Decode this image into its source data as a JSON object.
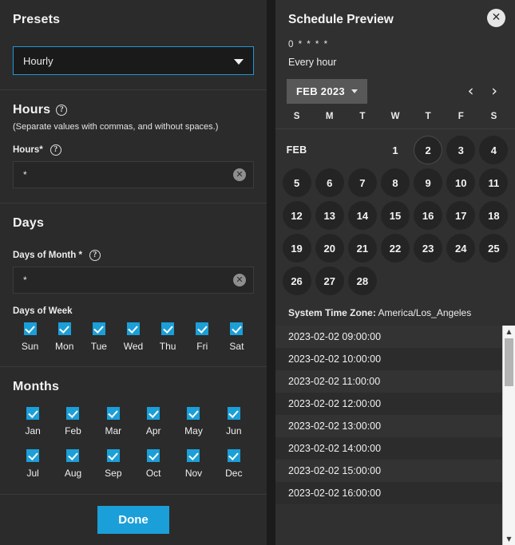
{
  "left": {
    "presets": {
      "title": "Presets",
      "value": "Hourly",
      "caret_icon": "chevron-down-icon"
    },
    "hours": {
      "title": "Hours",
      "help_icon": "?",
      "hint": "(Separate values with commas, and without spaces.)",
      "field_label": "Hours",
      "required_mark": "*",
      "value": "*",
      "clear_icon": "✕"
    },
    "days": {
      "title": "Days",
      "day_of_month_label": "Days of Month",
      "required_mark": "*",
      "day_of_month_value": "*",
      "clear_icon": "✕",
      "days_of_week_label": "Days of Week",
      "week": [
        {
          "label": "Sun",
          "checked": true
        },
        {
          "label": "Mon",
          "checked": true
        },
        {
          "label": "Tue",
          "checked": true
        },
        {
          "label": "Wed",
          "checked": true
        },
        {
          "label": "Thu",
          "checked": true
        },
        {
          "label": "Fri",
          "checked": true
        },
        {
          "label": "Sat",
          "checked": true
        }
      ]
    },
    "months": {
      "title": "Months",
      "items": [
        {
          "label": "Jan",
          "checked": true
        },
        {
          "label": "Feb",
          "checked": true
        },
        {
          "label": "Mar",
          "checked": true
        },
        {
          "label": "Apr",
          "checked": true
        },
        {
          "label": "May",
          "checked": true
        },
        {
          "label": "Jun",
          "checked": true
        },
        {
          "label": "Jul",
          "checked": true
        },
        {
          "label": "Aug",
          "checked": true
        },
        {
          "label": "Sep",
          "checked": true
        },
        {
          "label": "Oct",
          "checked": true
        },
        {
          "label": "Nov",
          "checked": true
        },
        {
          "label": "Dec",
          "checked": true
        }
      ]
    },
    "footer": {
      "done_label": "Done"
    }
  },
  "right": {
    "title": "Schedule Preview",
    "close_icon": "✕",
    "cron_expression": "0 * * * *",
    "cron_description": "Every hour",
    "calendar": {
      "month_chip": "FEB 2023",
      "chip_caret_icon": "chevron-down-icon",
      "prev_icon": "‹",
      "next_icon": "›",
      "weekday_headers": [
        "S",
        "M",
        "T",
        "W",
        "T",
        "F",
        "S"
      ],
      "month_label": "FEB",
      "cells": [
        {
          "text": "FEB",
          "style": "monthlabel"
        },
        {
          "text": "",
          "style": "empty"
        },
        {
          "text": "",
          "style": "empty"
        },
        {
          "text": "1",
          "style": "plain"
        },
        {
          "text": "2",
          "style": "today"
        },
        {
          "text": "3",
          "style": "filled"
        },
        {
          "text": "4",
          "style": "filled"
        },
        {
          "text": "5",
          "style": "filled"
        },
        {
          "text": "6",
          "style": "filled"
        },
        {
          "text": "7",
          "style": "filled"
        },
        {
          "text": "8",
          "style": "filled"
        },
        {
          "text": "9",
          "style": "filled"
        },
        {
          "text": "10",
          "style": "filled"
        },
        {
          "text": "11",
          "style": "filled"
        },
        {
          "text": "12",
          "style": "filled"
        },
        {
          "text": "13",
          "style": "filled"
        },
        {
          "text": "14",
          "style": "filled"
        },
        {
          "text": "15",
          "style": "filled"
        },
        {
          "text": "16",
          "style": "filled"
        },
        {
          "text": "17",
          "style": "filled"
        },
        {
          "text": "18",
          "style": "filled"
        },
        {
          "text": "19",
          "style": "filled"
        },
        {
          "text": "20",
          "style": "filled"
        },
        {
          "text": "21",
          "style": "filled"
        },
        {
          "text": "22",
          "style": "filled"
        },
        {
          "text": "23",
          "style": "filled"
        },
        {
          "text": "24",
          "style": "filled"
        },
        {
          "text": "25",
          "style": "filled"
        },
        {
          "text": "26",
          "style": "filled"
        },
        {
          "text": "27",
          "style": "filled"
        },
        {
          "text": "28",
          "style": "filled"
        },
        {
          "text": "",
          "style": "empty"
        },
        {
          "text": "",
          "style": "empty"
        },
        {
          "text": "",
          "style": "empty"
        },
        {
          "text": "",
          "style": "empty"
        }
      ]
    },
    "timezone_label": "System Time Zone:",
    "timezone_value": "America/Los_Angeles",
    "occurrences": [
      "2023-02-02 09:00:00",
      "2023-02-02 10:00:00",
      "2023-02-02 11:00:00",
      "2023-02-02 12:00:00",
      "2023-02-02 13:00:00",
      "2023-02-02 14:00:00",
      "2023-02-02 15:00:00",
      "2023-02-02 16:00:00"
    ],
    "scrollbar": {
      "up_icon": "▲",
      "down_icon": "▼"
    }
  },
  "colors": {
    "accent": "#1b9fd8",
    "panel_bg": "#2b2b2b",
    "preview_bg": "#303030",
    "focus_border": "#2196d6"
  }
}
